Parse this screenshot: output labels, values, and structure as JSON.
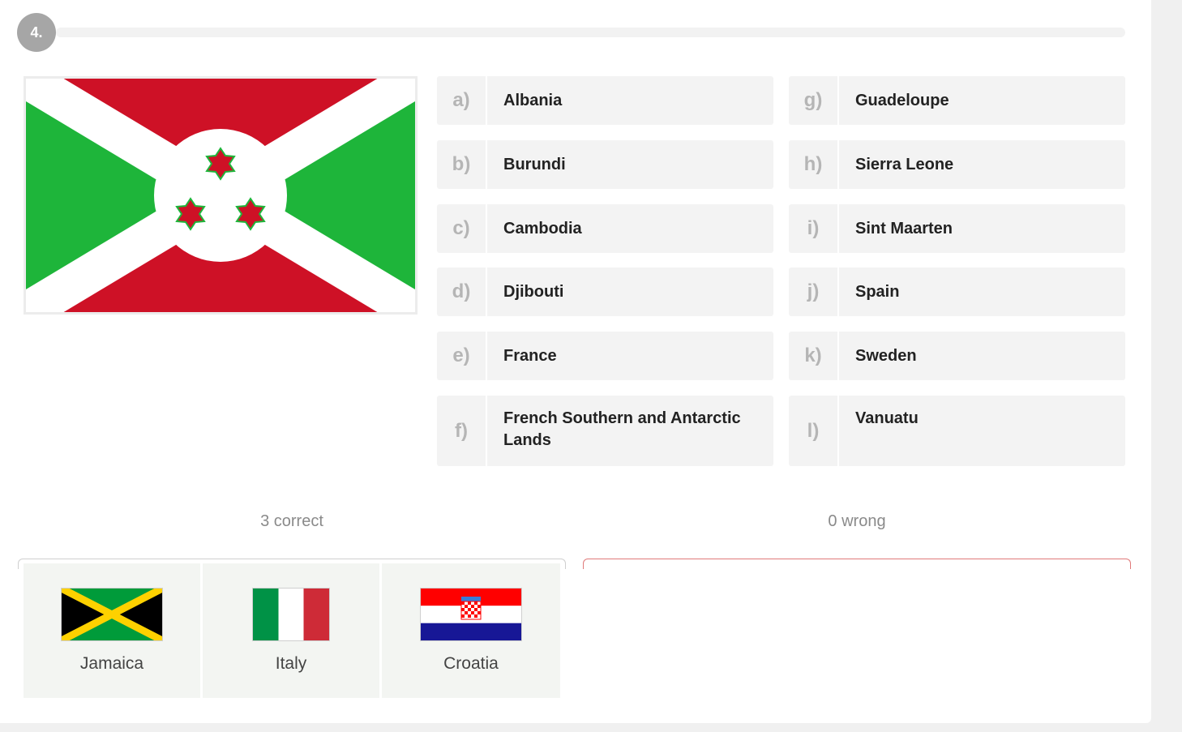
{
  "question": {
    "number": "4."
  },
  "flag": {
    "icon": "burundi-flag",
    "colors": {
      "red": "#ce1126",
      "green": "#1eb53a",
      "white": "#ffffff"
    }
  },
  "options": [
    {
      "letter": "a)",
      "label": "Albania"
    },
    {
      "letter": "b)",
      "label": "Burundi"
    },
    {
      "letter": "c)",
      "label": "Cambodia"
    },
    {
      "letter": "d)",
      "label": "Djibouti"
    },
    {
      "letter": "e)",
      "label": "France"
    },
    {
      "letter": "f)",
      "label": "French Southern and Antarctic Lands"
    },
    {
      "letter": "g)",
      "label": "Guadeloupe"
    },
    {
      "letter": "h)",
      "label": "Sierra Leone"
    },
    {
      "letter": "i)",
      "label": "Sint Maarten"
    },
    {
      "letter": "j)",
      "label": "Spain"
    },
    {
      "letter": "k)",
      "label": "Sweden"
    },
    {
      "letter": "l)",
      "label": "Vanuatu"
    }
  ],
  "results": {
    "correct_label": "3 correct",
    "wrong_label": "0 wrong",
    "correct_items": [
      {
        "name": "Jamaica",
        "icon": "jamaica-flag"
      },
      {
        "name": "Italy",
        "icon": "italy-flag"
      },
      {
        "name": "Croatia",
        "icon": "croatia-flag"
      }
    ]
  }
}
